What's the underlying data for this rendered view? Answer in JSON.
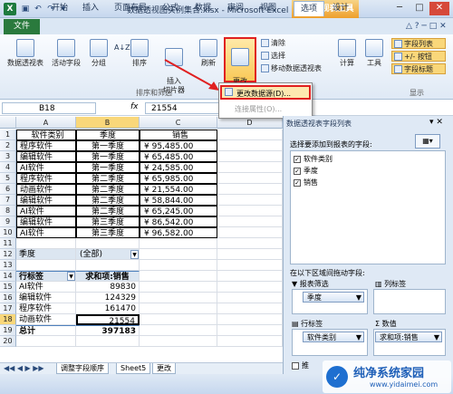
{
  "window": {
    "title": "数据透视图实例集合.xlsx - Microsoft Excel",
    "context_tab_group": "数据透视表工具",
    "controls": {
      "min": "─",
      "max": "□",
      "close": "✕"
    }
  },
  "tabs": [
    {
      "label": "文件"
    },
    {
      "label": "开始"
    },
    {
      "label": "插入"
    },
    {
      "label": "页面布局"
    },
    {
      "label": "公式"
    },
    {
      "label": "数据"
    },
    {
      "label": "审阅"
    },
    {
      "label": "视图"
    },
    {
      "label": "选项"
    },
    {
      "label": "设计"
    }
  ],
  "ribbon": {
    "pivot_table": "数据透视表",
    "active_field": "活动字段",
    "group": "分组",
    "sort_az": "A↓Z",
    "sort": "排序",
    "insert_slicer": "插入\n切片器",
    "refresh": "刷新",
    "change_source": "更改\n数据源",
    "clear": "清除",
    "select": "选择",
    "move_pivot": "移动数据透视表",
    "calculate": "计算",
    "tools": "工具",
    "field_list": "字段列表",
    "plus_minus": "+/- 按钮",
    "field_headers": "字段标题",
    "group_sort_filter": "排序和筛选",
    "group_show": "显示"
  },
  "dropdown": {
    "item1": "更改数据源(D)...",
    "item2": "连接属性(O)..."
  },
  "formula_bar": {
    "name_box": "B18",
    "fx": "fx",
    "value": "21554"
  },
  "columns": [
    "A",
    "B",
    "C",
    "D"
  ],
  "rows": [
    {
      "n": "1",
      "a": "软件类别",
      "b": "季度",
      "c": "销售"
    },
    {
      "n": "2",
      "a": "程序软件",
      "b": "第一季度",
      "c": "¥  95,485.00"
    },
    {
      "n": "3",
      "a": "编辑软件",
      "b": "第一季度",
      "c": "¥  65,485.00"
    },
    {
      "n": "4",
      "a": "AI软件",
      "b": "第一季度",
      "c": "¥  24,585.00"
    },
    {
      "n": "5",
      "a": "程序软件",
      "b": "第二季度",
      "c": "¥  65,985.00"
    },
    {
      "n": "6",
      "a": "动画软件",
      "b": "第二季度",
      "c": "¥  21,554.00"
    },
    {
      "n": "7",
      "a": "编辑软件",
      "b": "第二季度",
      "c": "¥  58,844.00"
    },
    {
      "n": "8",
      "a": "AI软件",
      "b": "第二季度",
      "c": "¥  65,245.00"
    },
    {
      "n": "9",
      "a": "编辑软件",
      "b": "第三季度",
      "c": "¥  86,542.00"
    },
    {
      "n": "10",
      "a": "AI软件",
      "b": "第三季度",
      "c": "¥  96,582.00"
    },
    {
      "n": "11",
      "a": "",
      "b": "",
      "c": ""
    },
    {
      "n": "12",
      "a": "季度",
      "b": "(全部)",
      "c": ""
    },
    {
      "n": "13",
      "a": "",
      "b": "",
      "c": ""
    },
    {
      "n": "14",
      "a": "行标签",
      "b": "求和项:销售",
      "c": ""
    },
    {
      "n": "15",
      "a": "AI软件",
      "b": "89830",
      "c": ""
    },
    {
      "n": "16",
      "a": "编辑软件",
      "b": "124329",
      "c": ""
    },
    {
      "n": "17",
      "a": "程序软件",
      "b": "161470",
      "c": ""
    },
    {
      "n": "18",
      "a": "动画软件",
      "b": "21554",
      "c": ""
    },
    {
      "n": "19",
      "a": "总计",
      "b": "397183",
      "c": ""
    },
    {
      "n": "20",
      "a": "",
      "b": "",
      "c": ""
    }
  ],
  "sheet_tabs": [
    "调整字段顺序",
    "Sheet5",
    "更改"
  ],
  "panel": {
    "title": "数据透视表字段列表",
    "choose_label": "选择要添加到报表的字段:",
    "fields": [
      {
        "label": "软件类别",
        "checked": true
      },
      {
        "label": "季度",
        "checked": true
      },
      {
        "label": "销售",
        "checked": true
      }
    ],
    "drag_label": "在以下区域间拖动字段:",
    "report_filter": "报表筛选",
    "column_labels": "列标签",
    "row_labels": "行标签",
    "values": "数值",
    "filter_field": "季度",
    "row_field": "软件类别",
    "value_field": "求和项:销售",
    "defer_label": "推"
  },
  "watermark": {
    "line1": "纯净系统家园",
    "line2": "www.yidaimei.com"
  }
}
